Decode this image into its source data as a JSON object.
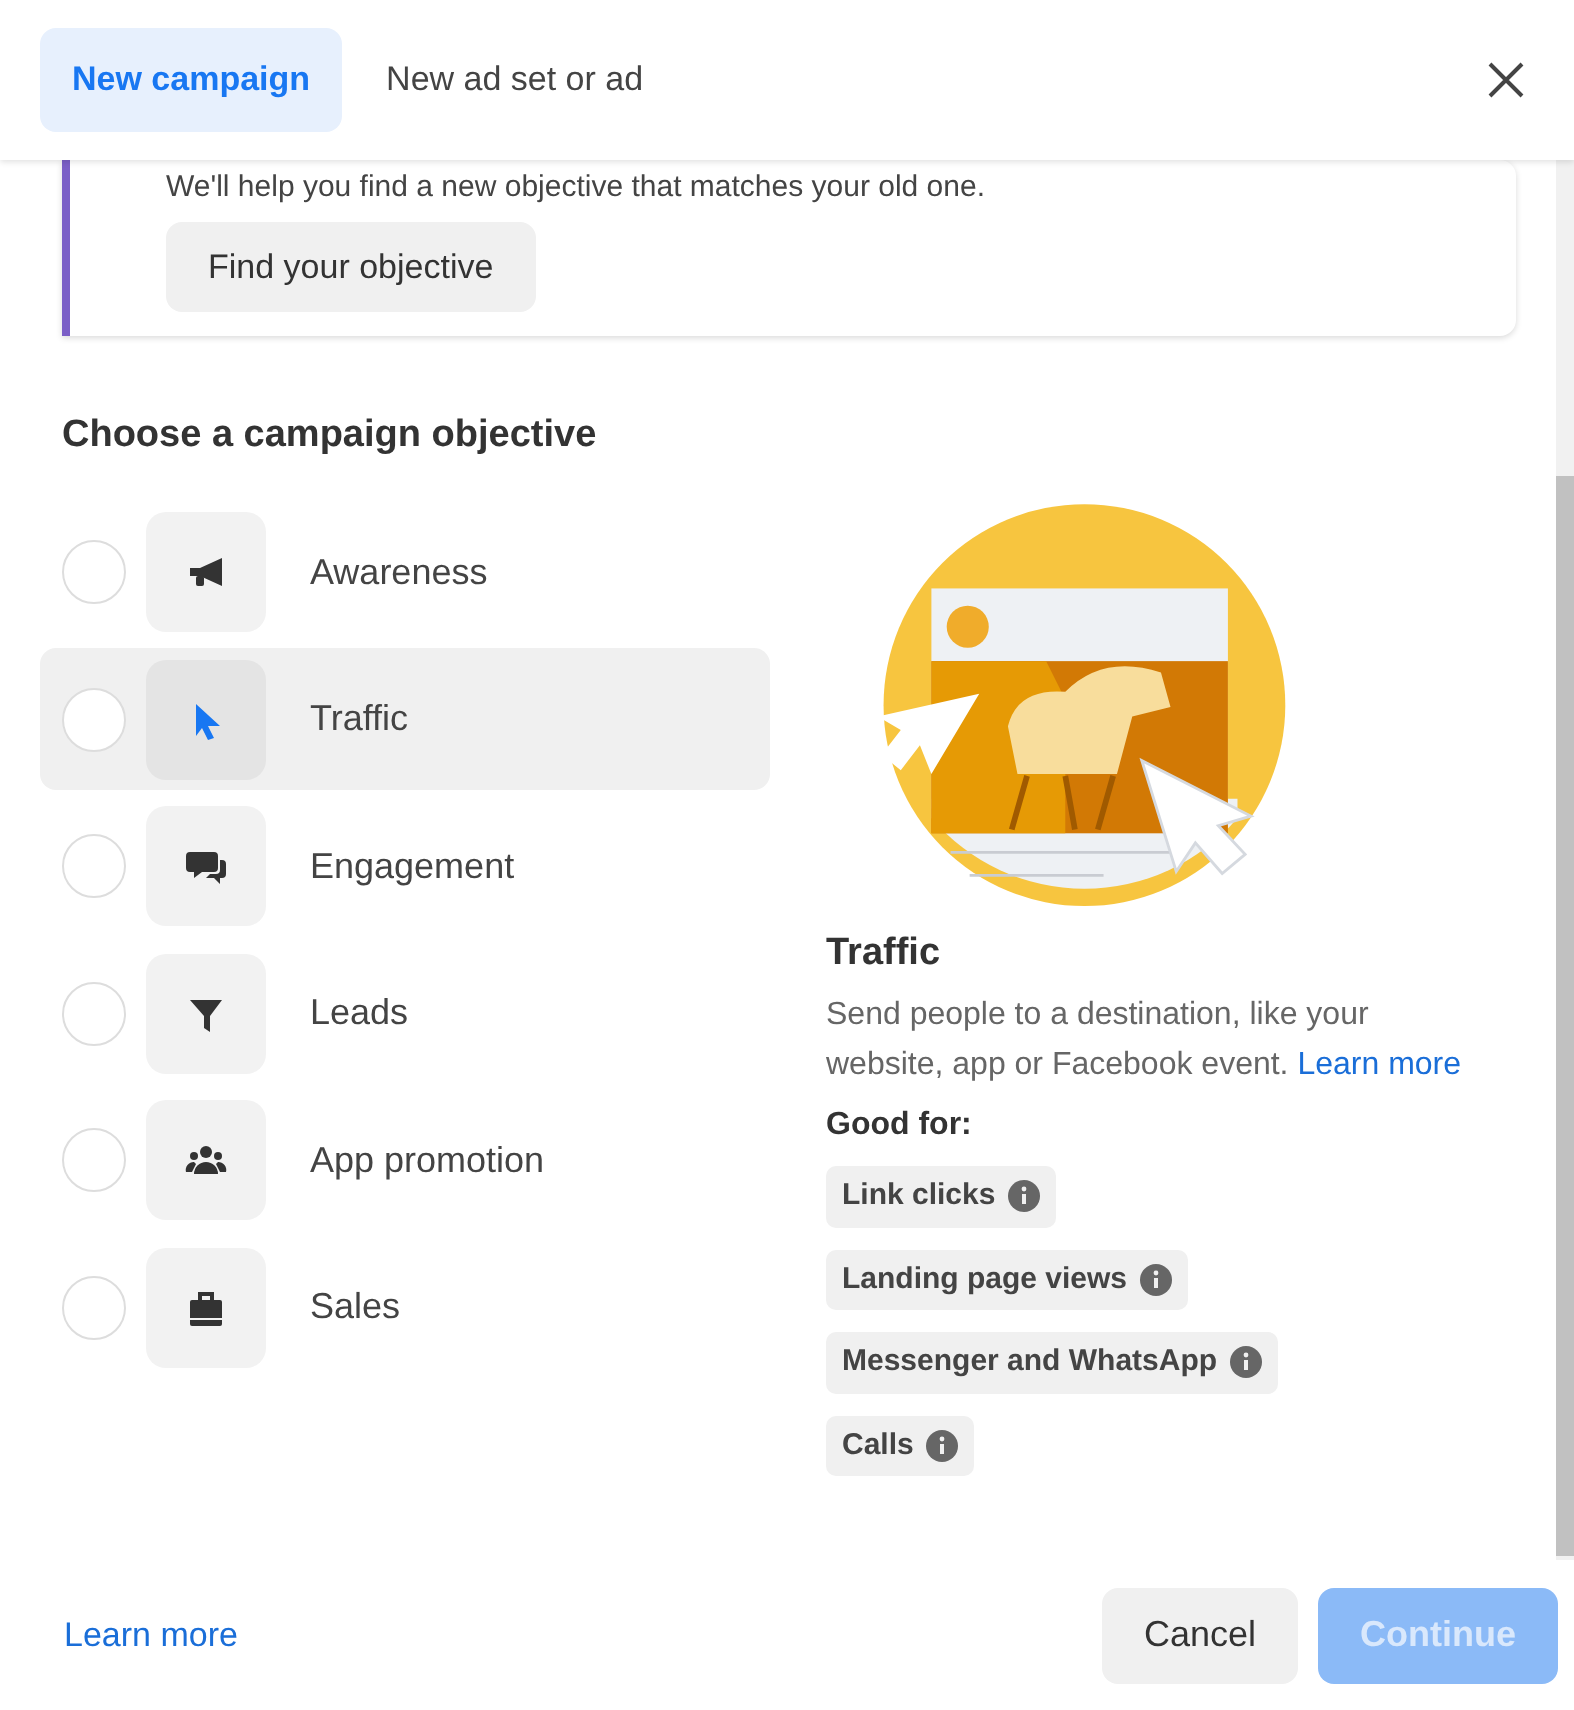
{
  "tabs": [
    {
      "label": "New campaign",
      "selected": true
    },
    {
      "label": "New ad set or ad",
      "selected": false
    }
  ],
  "notice": {
    "text": "We'll help you find a new objective that matches your old one.",
    "button": "Find your objective"
  },
  "objective_heading": "Choose a campaign objective",
  "objectives": [
    {
      "label": "Awareness",
      "kind": "megaphone",
      "checked": false,
      "selected": false
    },
    {
      "label": "Traffic",
      "kind": "cursor",
      "checked": false,
      "selected": true
    },
    {
      "label": "Engagement",
      "kind": "chat",
      "checked": false,
      "selected": false
    },
    {
      "label": "Leads",
      "kind": "funnel",
      "checked": false,
      "selected": false
    },
    {
      "label": "App promotion",
      "kind": "people",
      "checked": false,
      "selected": false
    },
    {
      "label": "Sales",
      "kind": "bag",
      "checked": false,
      "selected": false
    }
  ],
  "detail": {
    "title": "Traffic",
    "description": "Send people to a destination, like your website, app or Facebook event.",
    "link": "Learn more",
    "good_for_label": "Good for:",
    "tags": [
      "Link clicks",
      "Landing page views",
      "Messenger and WhatsApp",
      "Calls"
    ]
  },
  "footer": {
    "link": "Learn more",
    "buttons": [
      {
        "label": "Cancel",
        "kind": "secondary",
        "disabled": false
      },
      {
        "label": "Continue",
        "kind": "primary",
        "disabled": true
      }
    ]
  }
}
